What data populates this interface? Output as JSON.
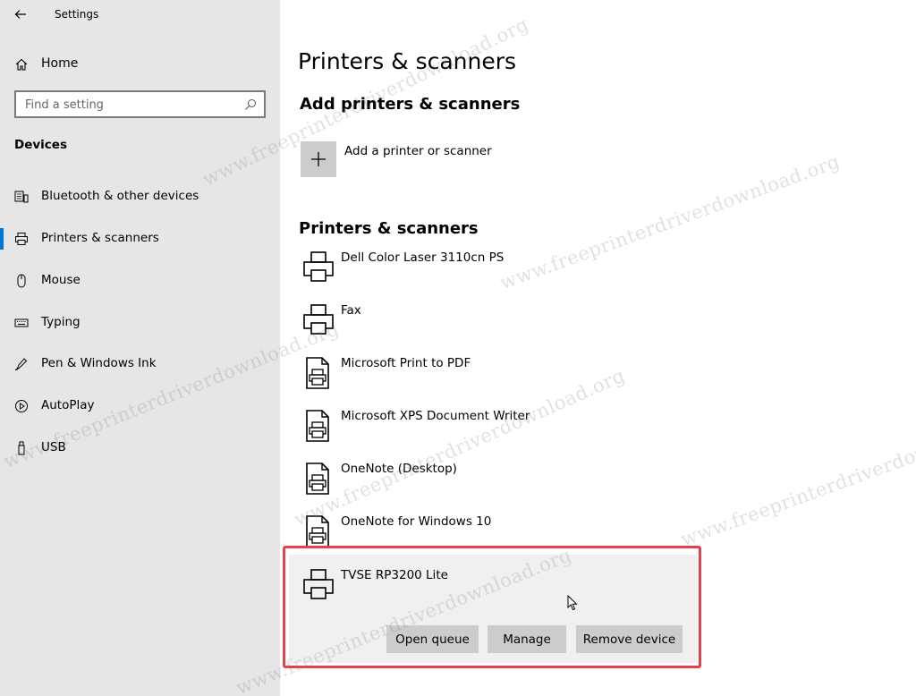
{
  "app": {
    "title": "Settings"
  },
  "sidebar": {
    "home_label": "Home",
    "search_placeholder": "Find a setting",
    "section": "Devices",
    "items": [
      {
        "label": "Bluetooth & other devices",
        "icon": "bluetooth-devices-icon"
      },
      {
        "label": "Printers & scanners",
        "icon": "printer-icon",
        "active": true
      },
      {
        "label": "Mouse",
        "icon": "mouse-icon"
      },
      {
        "label": "Typing",
        "icon": "keyboard-icon"
      },
      {
        "label": "Pen & Windows Ink",
        "icon": "pen-icon"
      },
      {
        "label": "AutoPlay",
        "icon": "autoplay-icon"
      },
      {
        "label": "USB",
        "icon": "usb-icon"
      }
    ]
  },
  "main": {
    "title": "Printers & scanners",
    "add_section_title": "Add printers & scanners",
    "add_label": "Add a printer or scanner",
    "list_title": "Printers & scanners",
    "printers": [
      {
        "name": "Dell Color Laser 3110cn PS",
        "icon": "printer-icon"
      },
      {
        "name": "Fax",
        "icon": "printer-icon"
      },
      {
        "name": "Microsoft Print to PDF",
        "icon": "document-printer-icon"
      },
      {
        "name": "Microsoft XPS Document Writer",
        "icon": "document-printer-icon"
      },
      {
        "name": "OneNote (Desktop)",
        "icon": "document-printer-icon"
      },
      {
        "name": "OneNote for Windows 10",
        "icon": "document-printer-icon"
      },
      {
        "name": "TVSE RP3200 Lite",
        "icon": "printer-icon",
        "selected": true
      }
    ],
    "actions": {
      "open_queue": "Open queue",
      "manage": "Manage",
      "remove_device": "Remove device"
    }
  },
  "watermark": {
    "text_1": "www.freeprinterdriverdownload.org",
    "text_2": "www.freeprinterdriverdownload.org",
    "text_3": "www.freeprinterdriverdownload.org",
    "text_4": "www.freeprinterdriverdownload.org",
    "text_5": "www.freeprinterdriverdown",
    "text_6": "www.freeprinterdriverdownload.org"
  },
  "colors": {
    "sidebar_bg": "#e6e6e6",
    "accent": "#0078d7",
    "highlight": "#e2424b",
    "button_bg": "#cccccc"
  }
}
